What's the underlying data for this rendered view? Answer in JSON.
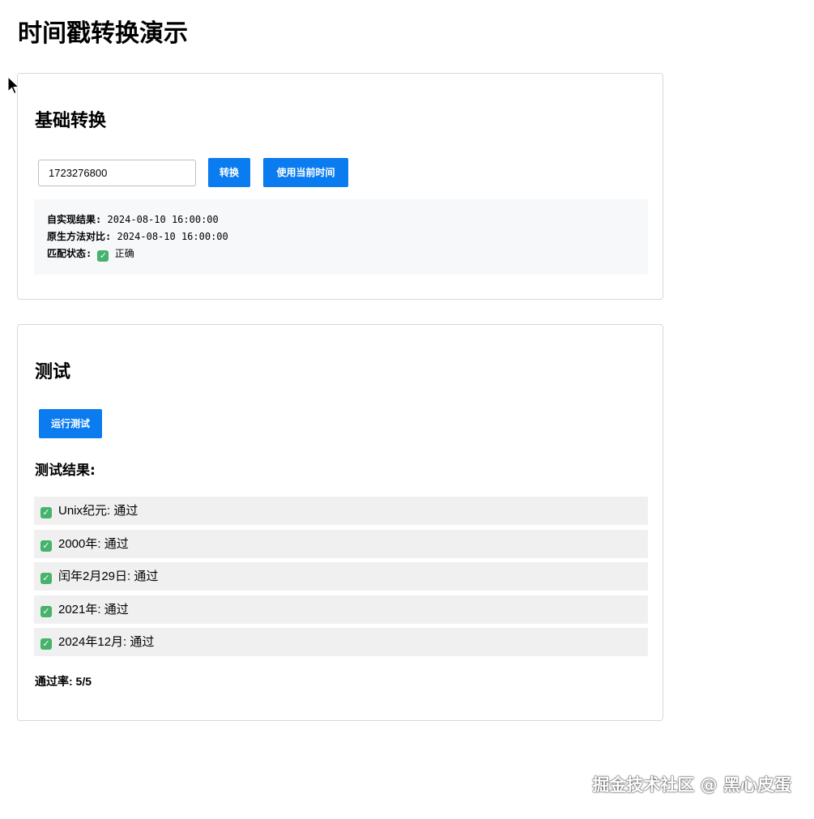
{
  "page": {
    "title": "时间戳转换演示"
  },
  "basic": {
    "title": "基础转换",
    "input_value": "1723276800",
    "convert_label": "转换",
    "now_label": "使用当前时间",
    "results": [
      {
        "label": "自实现结果:",
        "value": "2024-08-10 16:00:00"
      },
      {
        "label": "原生方法对比:",
        "value": "2024-08-10 16:00:00"
      },
      {
        "label": "匹配状态:",
        "value": "正确",
        "icon": "check-icon"
      }
    ]
  },
  "test": {
    "title": "测试",
    "run_label": "运行测试",
    "results_heading": "测试结果:",
    "items": [
      {
        "text": "Unix纪元: 通过",
        "icon": "check-icon"
      },
      {
        "text": "2000年: 通过",
        "icon": "check-icon"
      },
      {
        "text": "闰年2月29日: 通过",
        "icon": "check-icon"
      },
      {
        "text": "2021年: 通过",
        "icon": "check-icon"
      },
      {
        "text": "2024年12月: 通过",
        "icon": "check-icon"
      }
    ],
    "pass_rate": "通过率: 5/5"
  },
  "watermark": "掘金技术社区 @ 黑心皮蛋",
  "colors": {
    "accent": "#0a7cf0",
    "check": "#45b36b",
    "result_bg": "#f7f8f9",
    "item_bg": "#f0f0f0"
  }
}
